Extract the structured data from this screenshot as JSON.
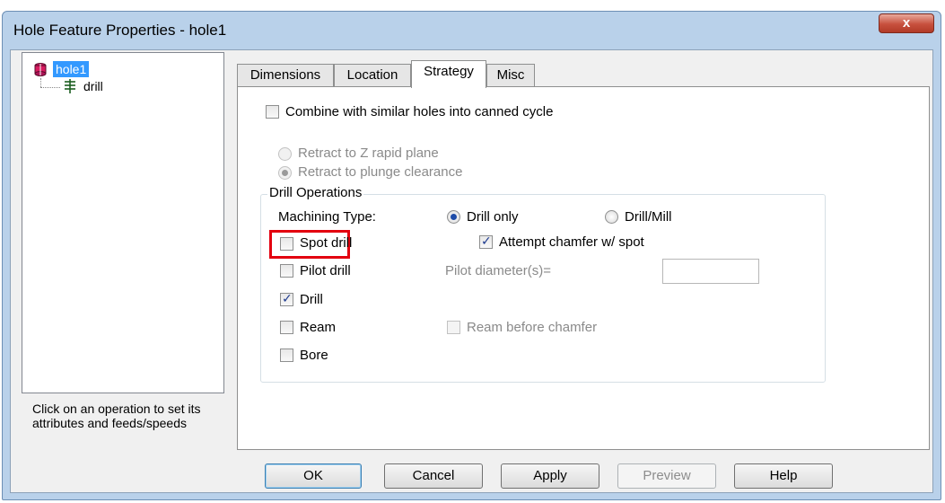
{
  "window": {
    "title": "Hole Feature Properties - hole1",
    "close_glyph": "x"
  },
  "tree": {
    "root_label": "hole1",
    "child_label": "drill"
  },
  "hint": "Click on an operation to set its attributes and feeds/speeds",
  "tabs": [
    {
      "label": "Dimensions",
      "active": false
    },
    {
      "label": "Location",
      "active": false
    },
    {
      "label": "Strategy",
      "active": true
    },
    {
      "label": "Misc",
      "active": false
    }
  ],
  "strategy": {
    "combine_label": "Combine with similar holes into canned cycle",
    "combine_checked": false,
    "retract_z_label": "Retract to Z rapid plane",
    "retract_plunge_label": "Retract to plunge clearance",
    "retract_selected": "plunge",
    "group_label": "Drill Operations",
    "machining_type_label": "Machining Type:",
    "drill_only_label": "Drill only",
    "drill_mill_label": "Drill/Mill",
    "machining_type_selected": "drill_only",
    "spot_drill_label": "Spot drill",
    "attempt_chamfer_label": "Attempt chamfer w/ spot",
    "pilot_drill_label": "Pilot drill",
    "pilot_diameter_label": "Pilot diameter(s)=",
    "pilot_diameter_value": "",
    "drill_label": "Drill",
    "ream_label": "Ream",
    "ream_before_chamfer_label": "Ream before chamfer",
    "bore_label": "Bore",
    "checks": {
      "spot_drill": false,
      "attempt_chamfer": true,
      "pilot_drill": false,
      "drill": true,
      "ream": false,
      "ream_before_chamfer": false,
      "bore": false
    }
  },
  "buttons": {
    "ok": "OK",
    "cancel": "Cancel",
    "apply": "Apply",
    "preview": "Preview",
    "help": "Help"
  },
  "colors": {
    "selection": "#3399ff",
    "highlight_box": "#e3000f",
    "dialog_frame": "#b9d1ea"
  }
}
